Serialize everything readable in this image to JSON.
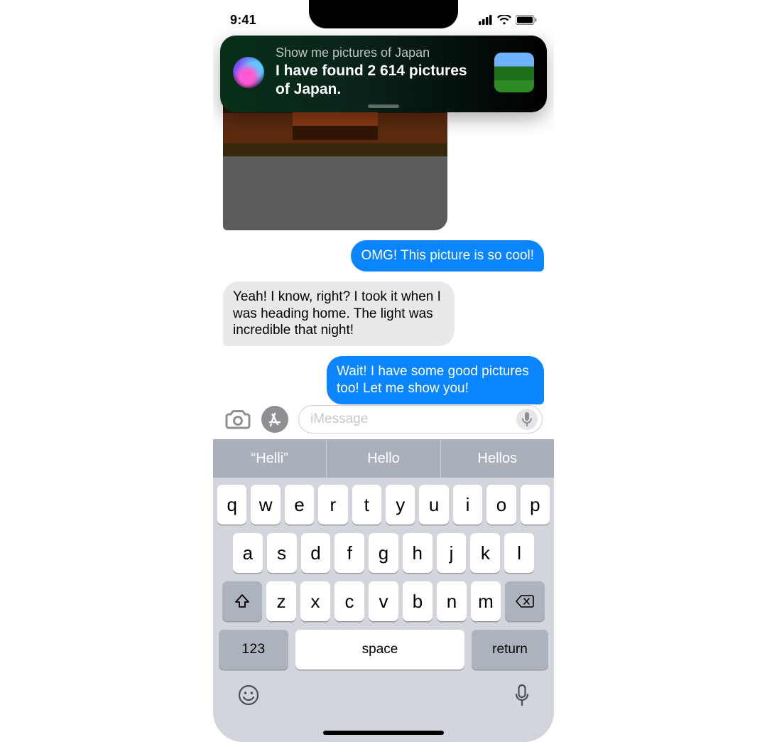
{
  "status": {
    "time": "9:41"
  },
  "siri": {
    "query": "Show me pictures of Japan",
    "response": "I have found 2 614 pictures of Japan."
  },
  "messages": {
    "m1": "OMG! This picture is so cool!",
    "m2": "Yeah! I know, right? I took it when I was heading home. The light was incredible that night!",
    "m3": "Wait! I have some good pictures too! Let me show you!"
  },
  "compose": {
    "placeholder": "iMessage"
  },
  "suggestions": {
    "s0": "“Helli”",
    "s1": "Hello",
    "s2": "Hellos"
  },
  "keyboard": {
    "row1": {
      "k0": "q",
      "k1": "w",
      "k2": "e",
      "k3": "r",
      "k4": "t",
      "k5": "y",
      "k6": "u",
      "k7": "i",
      "k8": "o",
      "k9": "p"
    },
    "row2": {
      "k0": "a",
      "k1": "s",
      "k2": "d",
      "k3": "f",
      "k4": "g",
      "k5": "h",
      "k6": "j",
      "k7": "k",
      "k8": "l"
    },
    "row3": {
      "k0": "z",
      "k1": "x",
      "k2": "c",
      "k3": "v",
      "k4": "b",
      "k5": "n",
      "k6": "m"
    },
    "numbers": "123",
    "space": "space",
    "enter": "return"
  }
}
